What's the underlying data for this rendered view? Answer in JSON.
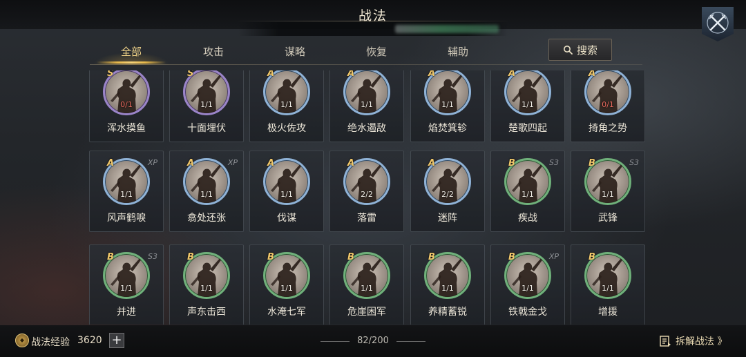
{
  "header": {
    "title": "战法"
  },
  "tabs": [
    {
      "label": "全部",
      "active": true
    },
    {
      "label": "攻击",
      "active": false
    },
    {
      "label": "谋略",
      "active": false
    },
    {
      "label": "恢复",
      "active": false
    },
    {
      "label": "辅助",
      "active": false
    }
  ],
  "search": {
    "label": "搜索",
    "icon": "search-icon"
  },
  "tactics": [
    {
      "name": "浑水摸鱼",
      "grade": "S",
      "count": "0/1",
      "count_color": "#e8695e",
      "tag": ""
    },
    {
      "name": "十面埋伏",
      "grade": "S",
      "count": "1/1",
      "count_color": "#f2efe8",
      "tag": ""
    },
    {
      "name": "极火佐攻",
      "grade": "A",
      "count": "1/1",
      "count_color": "#f2efe8",
      "tag": ""
    },
    {
      "name": "绝水遏敌",
      "grade": "A",
      "count": "1/1",
      "count_color": "#f2efe8",
      "tag": ""
    },
    {
      "name": "焰焚箕轸",
      "grade": "A",
      "count": "1/1",
      "count_color": "#f2efe8",
      "tag": ""
    },
    {
      "name": "楚歌四起",
      "grade": "A",
      "count": "1/1",
      "count_color": "#f2efe8",
      "tag": ""
    },
    {
      "name": "掎角之势",
      "grade": "A",
      "count": "0/1",
      "count_color": "#e8695e",
      "tag": ""
    },
    {
      "name": "风声鹤唳",
      "grade": "A",
      "count": "1/1",
      "count_color": "#f2efe8",
      "tag": "XP"
    },
    {
      "name": "翕处还张",
      "grade": "A",
      "count": "1/1",
      "count_color": "#f2efe8",
      "tag": "XP"
    },
    {
      "name": "伐谋",
      "grade": "A",
      "count": "1/1",
      "count_color": "#f2efe8",
      "tag": ""
    },
    {
      "name": "落雷",
      "grade": "A",
      "count": "2/2",
      "count_color": "#f2efe8",
      "tag": ""
    },
    {
      "name": "迷阵",
      "grade": "A",
      "count": "2/2",
      "count_color": "#f2efe8",
      "tag": ""
    },
    {
      "name": "疾战",
      "grade": "B",
      "count": "1/1",
      "count_color": "#f2efe8",
      "tag": "S3"
    },
    {
      "name": "武锋",
      "grade": "B",
      "count": "1/1",
      "count_color": "#f2efe8",
      "tag": "S3"
    },
    {
      "name": "并进",
      "grade": "B",
      "count": "1/1",
      "count_color": "#f2efe8",
      "tag": "S3"
    },
    {
      "name": "声东击西",
      "grade": "B",
      "count": "1/1",
      "count_color": "#f2efe8",
      "tag": ""
    },
    {
      "name": "水淹七军",
      "grade": "B",
      "count": "1/1",
      "count_color": "#f2efe8",
      "tag": ""
    },
    {
      "name": "危崖困军",
      "grade": "B",
      "count": "1/1",
      "count_color": "#f2efe8",
      "tag": ""
    },
    {
      "name": "养精蓄锐",
      "grade": "B",
      "count": "1/1",
      "count_color": "#f2efe8",
      "tag": ""
    },
    {
      "name": "铁戟金戈",
      "grade": "B",
      "count": "1/1",
      "count_color": "#f2efe8",
      "tag": "XP"
    },
    {
      "name": "增援",
      "grade": "B",
      "count": "1/1",
      "count_color": "#f2efe8",
      "tag": ""
    }
  ],
  "footer": {
    "exp_label": "战法经验",
    "exp_value": "3620",
    "plus_label": "+",
    "page_count": "82/200",
    "disassemble_label": "拆解战法 》"
  },
  "colors": {
    "accent_gold": "#f3d68a",
    "grade_s": "#9a84c8",
    "grade_a": "#8fb2d6",
    "grade_b": "#6fb07a"
  }
}
